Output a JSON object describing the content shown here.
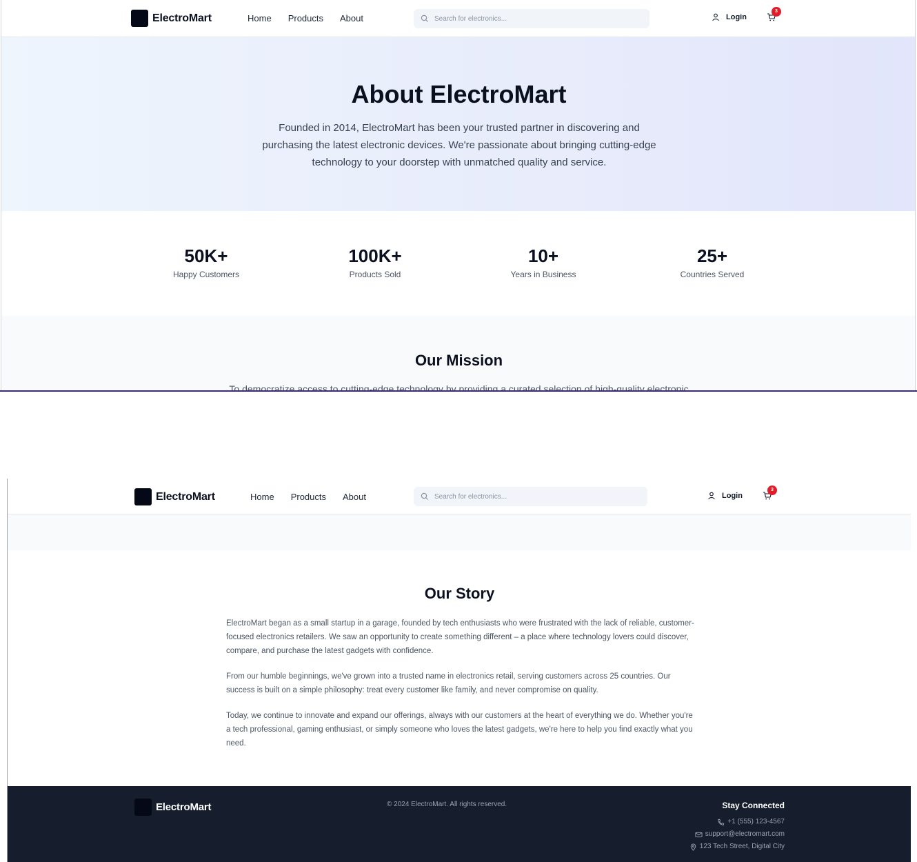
{
  "header": {
    "brand": "ElectroMart",
    "nav": [
      "Home",
      "Products",
      "About"
    ],
    "search_placeholder": "Search for electronics...",
    "login_label": "Login",
    "cart_count": "3"
  },
  "hero": {
    "title": "About ElectroMart",
    "description": "Founded in 2014, ElectroMart has been your trusted partner in discovering and purchasing the latest electronic devices. We're passionate about bringing cutting-edge technology to your doorstep with unmatched quality and service."
  },
  "stats": [
    {
      "value": "50K+",
      "label": "Happy Customers"
    },
    {
      "value": "100K+",
      "label": "Products Sold"
    },
    {
      "value": "10+",
      "label": "Years in Business"
    },
    {
      "value": "25+",
      "label": "Countries Served"
    }
  ],
  "mission": {
    "title": "Our Mission",
    "text_start": "To democratize access to cutting-edge technology by providing a curated selection of high-quality electronic"
  },
  "story": {
    "title": "Our Story",
    "paragraphs": [
      "ElectroMart began as a small startup in a garage, founded by tech enthusiasts who were frustrated with the lack of reliable, customer-focused electronics retailers. We saw an opportunity to create something different – a place where technology lovers could discover, compare, and purchase the latest gadgets with confidence.",
      "From our humble beginnings, we've grown into a trusted name in electronics retail, serving customers across 25 countries. Our success is built on a simple philosophy: treat every customer like family, and never compromise on quality.",
      "Today, we continue to innovate and expand our offerings, always with our customers at the heart of everything we do. Whether you're a tech professional, gaming enthusiast, or simply someone who loves the latest gadgets, we're here to help you find exactly what you need."
    ]
  },
  "footer": {
    "brand": "ElectroMart",
    "copyright": "© 2024 ElectroMart. All rights reserved.",
    "contact_title": "Stay Connected",
    "phone": "+1 (555) 123-4567",
    "email": "support@electromart.com",
    "address": "123 Tech Street, Digital City"
  },
  "colors": {
    "accent_badge": "#e11d2a",
    "footer_bg": "#161e2e",
    "text_dark": "#0b1020"
  },
  "icons": [
    "search-icon",
    "user-icon",
    "cart-icon",
    "phone-icon",
    "mail-icon",
    "map-pin-icon"
  ]
}
